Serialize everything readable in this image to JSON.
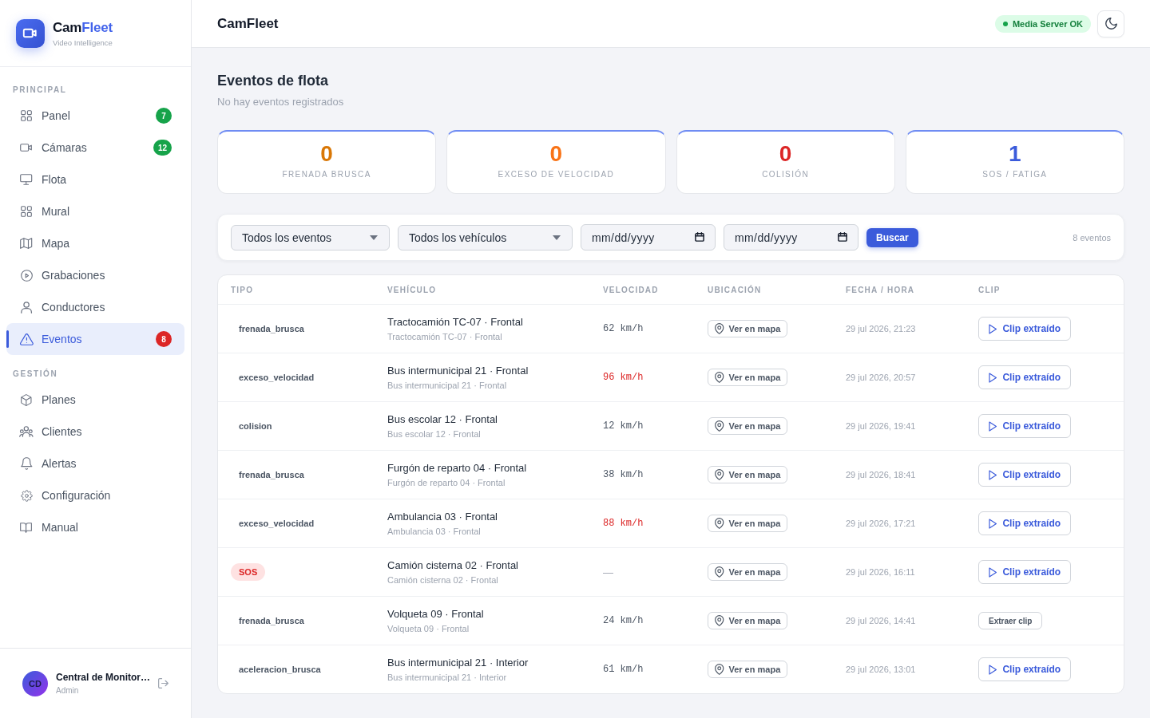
{
  "sidebar": {
    "brand": {
      "name": "Cam",
      "accent": "Fleet",
      "tagline": "Video Intelligence"
    },
    "sections": [
      {
        "title": "PRINCIPAL",
        "items": [
          {
            "label": "Panel",
            "selected": false,
            "badge": {
              "text": "7",
              "color": "#16a34a"
            }
          },
          {
            "label": "Cámaras",
            "selected": false,
            "badge": {
              "text": "12",
              "color": "#16a34a"
            }
          },
          {
            "label": "Flota",
            "selected": false
          },
          {
            "label": "Mural",
            "selected": false
          },
          {
            "label": "Mapa",
            "selected": false
          },
          {
            "label": "Grabaciones",
            "selected": false
          },
          {
            "label": "Conductores",
            "selected": false
          },
          {
            "label": "Eventos",
            "selected": true,
            "badge": {
              "text": "8",
              "color": "#dc2626"
            }
          }
        ]
      },
      {
        "title": "GESTIÓN",
        "items": [
          {
            "label": "Planes",
            "selected": false
          },
          {
            "label": "Clientes",
            "selected": false
          },
          {
            "label": "Alertas",
            "selected": false
          },
          {
            "label": "Configuración",
            "selected": false
          },
          {
            "label": "Manual",
            "selected": false
          }
        ]
      }
    ],
    "user": {
      "initials": "CD",
      "name": "Central de Monitor…",
      "role": "Admin"
    }
  },
  "header": {
    "title": "CamFleet",
    "status": {
      "label": "Media Server OK",
      "healthy": true
    }
  },
  "page": {
    "title": "Eventos de flota",
    "subtitle": "No hay eventos registrados"
  },
  "stats": [
    {
      "value": "0",
      "label": "FRENADA BRUSCA",
      "color": "#d97706"
    },
    {
      "value": "0",
      "label": "EXCESO DE VELOCIDAD",
      "color": "#f97316"
    },
    {
      "value": "0",
      "label": "COLISIÓN",
      "color": "#dc2626"
    },
    {
      "value": "1",
      "label": "SOS / FATIGA",
      "color": "#3b5bdb"
    }
  ],
  "filters": {
    "event_type": "Todos los eventos",
    "vehicle": "Todos los vehículos",
    "date_from": {
      "placeholder": "mm/dd/yyyy"
    },
    "date_to": {
      "placeholder": "mm/dd/yyyy"
    },
    "search_button": "Buscar",
    "count": "8 eventos"
  },
  "table": {
    "columns": [
      "TIPO",
      "VEHÍCULO",
      "VELOCIDAD",
      "UBICACIÓN",
      "FECHA / HORA",
      "CLIP"
    ],
    "rows": [
      {
        "type": {
          "label": "frenada_brusca",
          "kind": "plain"
        },
        "vehicle": {
          "name": "Tractocamión TC-07 · Frontal",
          "camera": "Tractocamión TC-07 · Frontal"
        },
        "speed": {
          "value": "62 km/h",
          "over_limit": false,
          "available": true
        },
        "location": "Ver en mapa",
        "datetime": "29 jul 2026, 21:23",
        "clip": {
          "label": "Clip extraído",
          "extracted": true
        }
      },
      {
        "type": {
          "label": "exceso_velocidad",
          "kind": "plain"
        },
        "vehicle": {
          "name": "Bus intermunicipal 21 · Frontal",
          "camera": "Bus intermunicipal 21 · Frontal"
        },
        "speed": {
          "value": "96 km/h",
          "over_limit": true,
          "available": true
        },
        "location": "Ver en mapa",
        "datetime": "29 jul 2026, 20:57",
        "clip": {
          "label": "Clip extraído",
          "extracted": true
        }
      },
      {
        "type": {
          "label": "colision",
          "kind": "plain"
        },
        "vehicle": {
          "name": "Bus escolar 12 · Frontal",
          "camera": "Bus escolar 12 · Frontal"
        },
        "speed": {
          "value": "12 km/h",
          "over_limit": false,
          "available": true
        },
        "location": "Ver en mapa",
        "datetime": "29 jul 2026, 19:41",
        "clip": {
          "label": "Clip extraído",
          "extracted": true
        }
      },
      {
        "type": {
          "label": "frenada_brusca",
          "kind": "plain"
        },
        "vehicle": {
          "name": "Furgón de reparto 04 · Frontal",
          "camera": "Furgón de reparto 04 · Frontal"
        },
        "speed": {
          "value": "38 km/h",
          "over_limit": false,
          "available": true
        },
        "location": "Ver en mapa",
        "datetime": "29 jul 2026, 18:41",
        "clip": {
          "label": "Clip extraído",
          "extracted": true
        }
      },
      {
        "type": {
          "label": "exceso_velocidad",
          "kind": "plain"
        },
        "vehicle": {
          "name": "Ambulancia 03 · Frontal",
          "camera": "Ambulancia 03 · Frontal"
        },
        "speed": {
          "value": "88 km/h",
          "over_limit": true,
          "available": true
        },
        "location": "Ver en mapa",
        "datetime": "29 jul 2026, 17:21",
        "clip": {
          "label": "Clip extraído",
          "extracted": true
        }
      },
      {
        "type": {
          "label": "SOS",
          "kind": "pill"
        },
        "vehicle": {
          "name": "Camión cisterna 02 · Frontal",
          "camera": "Camión cisterna 02 · Frontal"
        },
        "speed": {
          "value": "—",
          "over_limit": false,
          "available": false
        },
        "location": "Ver en mapa",
        "datetime": "29 jul 2026, 16:11",
        "clip": {
          "label": "Clip extraído",
          "extracted": true
        }
      },
      {
        "type": {
          "label": "frenada_brusca",
          "kind": "plain"
        },
        "vehicle": {
          "name": "Volqueta 09 · Frontal",
          "camera": "Volqueta 09 · Frontal"
        },
        "speed": {
          "value": "24 km/h",
          "over_limit": false,
          "available": true
        },
        "location": "Ver en mapa",
        "datetime": "29 jul 2026, 14:41",
        "clip": {
          "label": "Extraer clip",
          "extracted": false
        }
      },
      {
        "type": {
          "label": "aceleracion_brusca",
          "kind": "plain"
        },
        "vehicle": {
          "name": "Bus intermunicipal 21 · Interior",
          "camera": "Bus intermunicipal 21 · Interior"
        },
        "speed": {
          "value": "61 km/h",
          "over_limit": false,
          "available": true
        },
        "location": "Ver en mapa",
        "datetime": "29 jul 2026, 13:01",
        "clip": {
          "label": "Clip extraído",
          "extracted": true
        }
      }
    ]
  }
}
